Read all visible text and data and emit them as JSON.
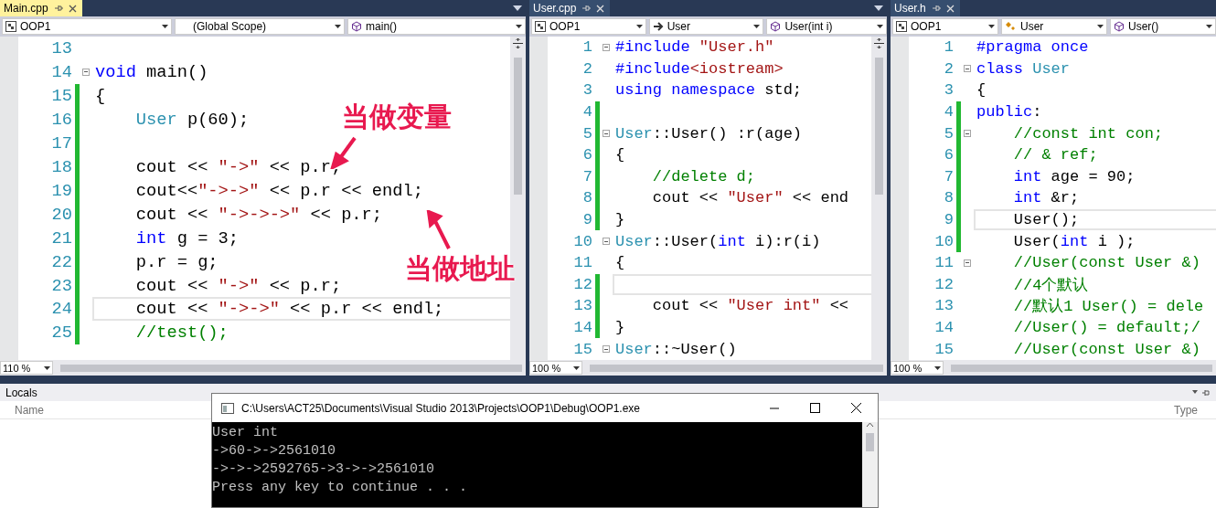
{
  "editors": [
    {
      "tab": {
        "label": "Main.cpp",
        "selected": true
      },
      "clipped": false,
      "navigation": [
        {
          "text": "OOP1",
          "kind": "project"
        },
        {
          "text": "(Global Scope)",
          "kind": "scope"
        },
        {
          "text": "main()",
          "kind": "method"
        }
      ],
      "zoom": "110 %",
      "lines": [
        {
          "number": "13",
          "modified": false,
          "fold": false,
          "current": false
        },
        {
          "number": "14",
          "modified": false,
          "fold": true,
          "current": false,
          "tokens": [
            {
              "text": "void",
              "kind": "keyword"
            },
            {
              "text": " main()",
              "kind": "plain"
            }
          ]
        },
        {
          "number": "15",
          "modified": true,
          "fold": false,
          "current": false,
          "tokens": [
            {
              "text": "{",
              "kind": "plain"
            }
          ]
        },
        {
          "number": "16",
          "modified": true,
          "fold": false,
          "current": false,
          "tokens": [
            {
              "text": "    User",
              "kind": "type"
            },
            {
              "text": " p(60);",
              "kind": "plain"
            }
          ]
        },
        {
          "number": "17",
          "modified": true,
          "fold": false,
          "current": false
        },
        {
          "number": "18",
          "modified": true,
          "fold": false,
          "current": false,
          "tokens": [
            {
              "text": "    cout << ",
              "kind": "plain"
            },
            {
              "text": "\"->\"",
              "kind": "string"
            },
            {
              "text": " << p.r;",
              "kind": "plain"
            }
          ]
        },
        {
          "number": "19",
          "modified": true,
          "fold": false,
          "current": false,
          "tokens": [
            {
              "text": "    cout<<",
              "kind": "plain"
            },
            {
              "text": "\"->->\"",
              "kind": "string"
            },
            {
              "text": " << p.r << endl;",
              "kind": "plain"
            }
          ]
        },
        {
          "number": "20",
          "modified": true,
          "fold": false,
          "current": false,
          "tokens": [
            {
              "text": "    cout << ",
              "kind": "plain"
            },
            {
              "text": "\"->->->\"",
              "kind": "string"
            },
            {
              "text": " << p.r;",
              "kind": "plain"
            }
          ]
        },
        {
          "number": "21",
          "modified": true,
          "fold": false,
          "current": false,
          "tokens": [
            {
              "text": "    int",
              "kind": "keyword"
            },
            {
              "text": " g = 3;",
              "kind": "plain"
            }
          ]
        },
        {
          "number": "22",
          "modified": true,
          "fold": false,
          "current": false,
          "tokens": [
            {
              "text": "    p.r = g;",
              "kind": "plain"
            }
          ]
        },
        {
          "number": "23",
          "modified": true,
          "fold": false,
          "current": false,
          "tokens": [
            {
              "text": "    cout << ",
              "kind": "plain"
            },
            {
              "text": "\"->\"",
              "kind": "string"
            },
            {
              "text": " << p.r;",
              "kind": "plain"
            }
          ]
        },
        {
          "number": "24",
          "modified": true,
          "fold": false,
          "current": true,
          "tokens": [
            {
              "text": "    cout << ",
              "kind": "plain"
            },
            {
              "text": "\"->->\"",
              "kind": "string"
            },
            {
              "text": " << p.r << endl;",
              "kind": "plain"
            }
          ]
        },
        {
          "number": "25",
          "modified": true,
          "fold": false,
          "current": false,
          "tokens": [
            {
              "text": "    //test();",
              "kind": "comment"
            }
          ]
        }
      ]
    },
    {
      "tab": {
        "label": "User.cpp",
        "selected": false
      },
      "clipped": false,
      "navigation": [
        {
          "text": "OOP1",
          "kind": "project"
        },
        {
          "text": "User",
          "kind": "type"
        },
        {
          "text": "User(int i)",
          "kind": "method"
        }
      ],
      "zoom": "100 %",
      "lines": [
        {
          "number": "1",
          "modified": false,
          "fold": true,
          "current": false,
          "tokens": [
            {
              "text": "#include",
              "kind": "keyword"
            },
            {
              "text": " \"User.h\"",
              "kind": "string"
            }
          ]
        },
        {
          "number": "2",
          "modified": false,
          "fold": false,
          "current": false,
          "tokens": [
            {
              "text": "#include",
              "kind": "keyword"
            },
            {
              "text": "<iostream>",
              "kind": "string"
            }
          ]
        },
        {
          "number": "3",
          "modified": false,
          "fold": false,
          "current": false,
          "tokens": [
            {
              "text": "using namespace",
              "kind": "keyword"
            },
            {
              "text": " std;",
              "kind": "plain"
            }
          ]
        },
        {
          "number": "4",
          "modified": true,
          "fold": false,
          "current": false
        },
        {
          "number": "5",
          "modified": true,
          "fold": true,
          "current": false,
          "tokens": [
            {
              "text": "User",
              "kind": "type"
            },
            {
              "text": "::User() :r(age)",
              "kind": "plain"
            }
          ]
        },
        {
          "number": "6",
          "modified": true,
          "fold": false,
          "current": false,
          "tokens": [
            {
              "text": "{",
              "kind": "plain"
            }
          ]
        },
        {
          "number": "7",
          "modified": true,
          "fold": false,
          "current": false,
          "tokens": [
            {
              "text": "    //delete d;",
              "kind": "comment"
            }
          ]
        },
        {
          "number": "8",
          "modified": true,
          "fold": false,
          "current": false,
          "tokens": [
            {
              "text": "    cout << ",
              "kind": "plain"
            },
            {
              "text": "\"User\"",
              "kind": "string"
            },
            {
              "text": " << end",
              "kind": "plain"
            }
          ]
        },
        {
          "number": "9",
          "modified": true,
          "fold": false,
          "current": false,
          "tokens": [
            {
              "text": "}",
              "kind": "plain"
            }
          ]
        },
        {
          "number": "10",
          "modified": false,
          "fold": true,
          "current": false,
          "tokens": [
            {
              "text": "User",
              "kind": "type"
            },
            {
              "text": "::User(",
              "kind": "plain"
            },
            {
              "text": "int",
              "kind": "keyword"
            },
            {
              "text": " i):r(i)",
              "kind": "plain"
            }
          ]
        },
        {
          "number": "11",
          "modified": false,
          "fold": false,
          "current": false,
          "tokens": [
            {
              "text": "{",
              "kind": "plain"
            }
          ]
        },
        {
          "number": "12",
          "modified": true,
          "fold": false,
          "current": true
        },
        {
          "number": "13",
          "modified": true,
          "fold": false,
          "current": false,
          "tokens": [
            {
              "text": "    cout << ",
              "kind": "plain"
            },
            {
              "text": "\"User int\"",
              "kind": "string"
            },
            {
              "text": " <<",
              "kind": "plain"
            }
          ]
        },
        {
          "number": "14",
          "modified": true,
          "fold": false,
          "current": false,
          "tokens": [
            {
              "text": "}",
              "kind": "plain"
            }
          ]
        },
        {
          "number": "15",
          "modified": false,
          "fold": true,
          "current": false,
          "tokens": [
            {
              "text": "User",
              "kind": "type"
            },
            {
              "text": "::~User()",
              "kind": "plain"
            }
          ]
        }
      ]
    },
    {
      "tab": {
        "label": "User.h",
        "selected": false
      },
      "clipped": true,
      "navigation": [
        {
          "text": "OOP1",
          "kind": "project"
        },
        {
          "text": "User",
          "kind": "class"
        },
        {
          "text": "User()",
          "kind": "method"
        }
      ],
      "zoom": "100 %",
      "lines": [
        {
          "number": "1",
          "modified": false,
          "fold": false,
          "current": false,
          "tokens": [
            {
              "text": "#pragma once",
              "kind": "keyword"
            }
          ]
        },
        {
          "number": "2",
          "modified": false,
          "fold": true,
          "current": false,
          "tokens": [
            {
              "text": "class",
              "kind": "keyword"
            },
            {
              "text": " User",
              "kind": "type"
            }
          ]
        },
        {
          "number": "3",
          "modified": false,
          "fold": false,
          "current": false,
          "tokens": [
            {
              "text": "{",
              "kind": "plain"
            }
          ]
        },
        {
          "number": "4",
          "modified": true,
          "fold": false,
          "current": false,
          "tokens": [
            {
              "text": "public",
              "kind": "keyword"
            },
            {
              "text": ":",
              "kind": "plain"
            }
          ]
        },
        {
          "number": "5",
          "modified": true,
          "fold": true,
          "current": false,
          "tokens": [
            {
              "text": "    //const int con;",
              "kind": "comment"
            }
          ]
        },
        {
          "number": "6",
          "modified": true,
          "fold": false,
          "current": false,
          "tokens": [
            {
              "text": "    // & ref;",
              "kind": "comment"
            }
          ]
        },
        {
          "number": "7",
          "modified": true,
          "fold": false,
          "current": false,
          "tokens": [
            {
              "text": "    int",
              "kind": "keyword"
            },
            {
              "text": " age = 90;",
              "kind": "plain"
            }
          ]
        },
        {
          "number": "8",
          "modified": true,
          "fold": false,
          "current": false,
          "tokens": [
            {
              "text": "    int",
              "kind": "keyword"
            },
            {
              "text": " &r;",
              "kind": "plain"
            }
          ]
        },
        {
          "number": "9",
          "modified": true,
          "fold": false,
          "current": true,
          "tokens": [
            {
              "text": "    User();",
              "kind": "plain"
            }
          ]
        },
        {
          "number": "10",
          "modified": true,
          "fold": false,
          "current": false,
          "tokens": [
            {
              "text": "    User(",
              "kind": "plain"
            },
            {
              "text": "int",
              "kind": "keyword"
            },
            {
              "text": " i );",
              "kind": "plain"
            }
          ]
        },
        {
          "number": "11",
          "modified": false,
          "fold": true,
          "current": false,
          "tokens": [
            {
              "text": "    //User(const User &)",
              "kind": "comment"
            }
          ]
        },
        {
          "number": "12",
          "modified": false,
          "fold": false,
          "current": false,
          "tokens": [
            {
              "text": "    //4个默认",
              "kind": "comment"
            }
          ]
        },
        {
          "number": "13",
          "modified": false,
          "fold": false,
          "current": false,
          "tokens": [
            {
              "text": "    //默认1 User() = dele",
              "kind": "comment"
            }
          ]
        },
        {
          "number": "14",
          "modified": false,
          "fold": false,
          "current": false,
          "tokens": [
            {
              "text": "    //User() = default;/",
              "kind": "comment"
            }
          ]
        },
        {
          "number": "15",
          "modified": false,
          "fold": false,
          "current": false,
          "tokens": [
            {
              "text": "    //User(const User &)",
              "kind": "comment"
            }
          ]
        }
      ]
    }
  ],
  "annotations": [
    {
      "text": "当做变量",
      "kind": "above"
    },
    {
      "text": "当做地址",
      "kind": "below"
    }
  ],
  "locals": {
    "title": "Locals",
    "columns": [
      "Name",
      "Type"
    ]
  },
  "console": {
    "title": "C:\\Users\\ACT25\\Documents\\Visual Studio 2013\\Projects\\OOP1\\Debug\\OOP1.exe",
    "lines": [
      "User int",
      "->60->->2561010",
      "->->->2592765->3->->2561010",
      "Press any key to continue . . ."
    ]
  }
}
